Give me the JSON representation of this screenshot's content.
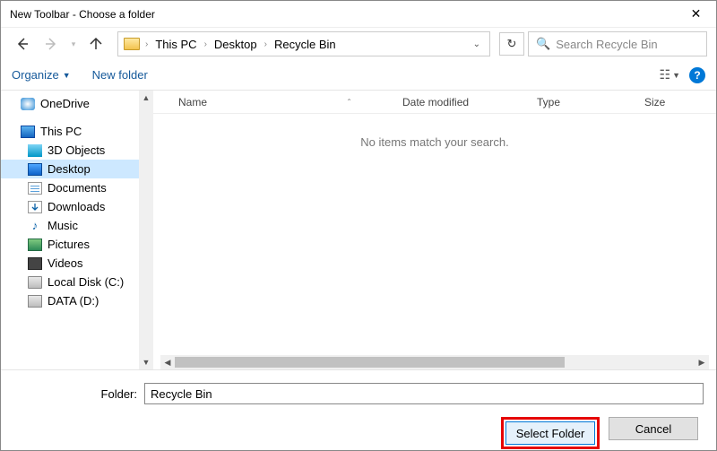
{
  "window": {
    "title": "New Toolbar - Choose a folder"
  },
  "nav": {
    "breadcrumbs": [
      "This PC",
      "Desktop",
      "Recycle Bin"
    ],
    "search_placeholder": "Search Recycle Bin"
  },
  "toolbar": {
    "organize": "Organize",
    "new_folder": "New folder"
  },
  "tree": {
    "items": [
      {
        "label": "OneDrive",
        "icon": "onedrive"
      },
      {
        "label": "This PC",
        "icon": "pc",
        "section": true
      },
      {
        "label": "3D Objects",
        "icon": "3d"
      },
      {
        "label": "Desktop",
        "icon": "desktop",
        "selected": true
      },
      {
        "label": "Documents",
        "icon": "docs"
      },
      {
        "label": "Downloads",
        "icon": "down"
      },
      {
        "label": "Music",
        "icon": "music"
      },
      {
        "label": "Pictures",
        "icon": "pics"
      },
      {
        "label": "Videos",
        "icon": "videos"
      },
      {
        "label": "Local Disk (C:)",
        "icon": "drive"
      },
      {
        "label": "DATA (D:)",
        "icon": "data"
      }
    ]
  },
  "columns": {
    "name": "Name",
    "date": "Date modified",
    "type": "Type",
    "size": "Size"
  },
  "list": {
    "empty": "No items match your search."
  },
  "footer": {
    "folder_label": "Folder:",
    "folder_value": "Recycle Bin",
    "select": "Select Folder",
    "cancel": "Cancel"
  }
}
